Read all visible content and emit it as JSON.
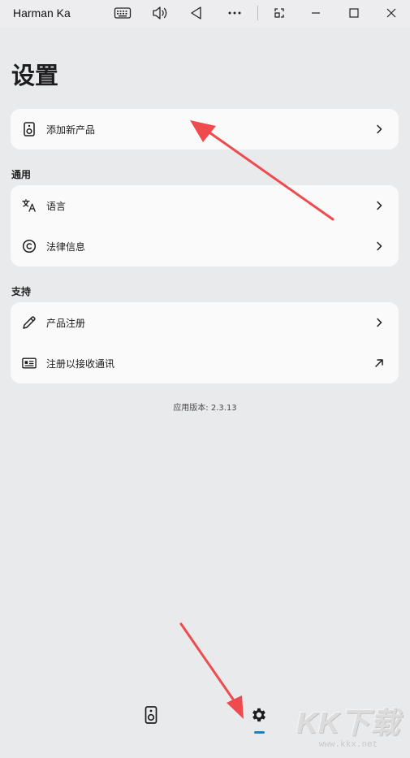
{
  "window": {
    "title": "Harman Ka",
    "buttons": [
      "keyboard-icon",
      "volume-icon",
      "back-icon",
      "more-icon",
      "restore-icon",
      "minimize-icon",
      "maximize-icon",
      "close-icon"
    ]
  },
  "page": {
    "title": "设置"
  },
  "cards": {
    "add_product": {
      "label": "添加新产品",
      "icon": "speaker-icon"
    },
    "general": {
      "heading": "通用",
      "items": [
        {
          "label": "语言",
          "icon": "translate-icon"
        },
        {
          "label": "法律信息",
          "icon": "copyright-icon"
        }
      ]
    },
    "support": {
      "heading": "支持",
      "items": [
        {
          "label": "产品注册",
          "icon": "pencil-icon"
        },
        {
          "label": "注册以接收通讯",
          "icon": "newsletter-icon"
        }
      ]
    }
  },
  "version": "应用版本: 2.3.13",
  "bottom_nav": {
    "items": [
      {
        "name": "devices",
        "icon": "speaker-icon"
      },
      {
        "name": "settings",
        "icon": "gear-icon",
        "selected": true
      }
    ],
    "accent": "#1a7fc4"
  },
  "annotation_color": "#ef4b4f",
  "watermark": {
    "big": "KK下载",
    "small": "www.kkx.net"
  }
}
